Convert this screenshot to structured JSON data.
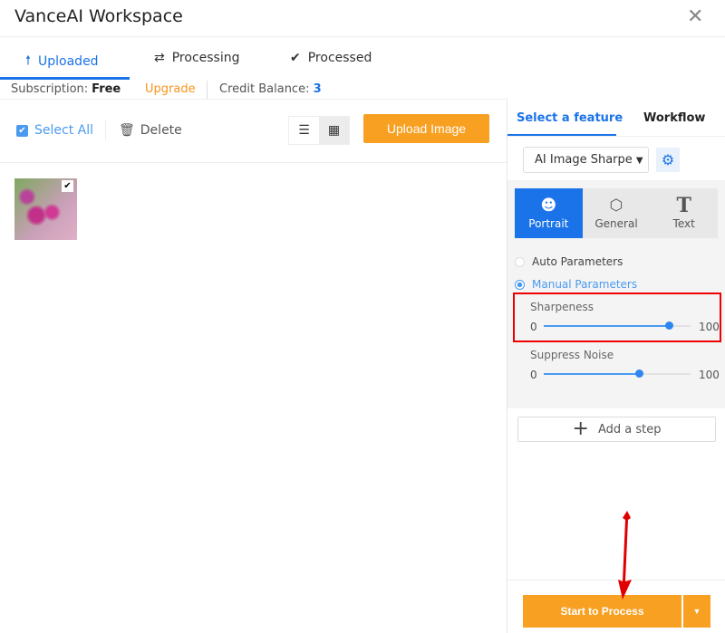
{
  "window": {
    "title": "VanceAI Workspace",
    "close_icon": "close-icon"
  },
  "tabs": [
    {
      "label": "Uploaded",
      "icon": "upload-arrow-icon",
      "active": true
    },
    {
      "label": "Processing",
      "icon": "sync-icon"
    },
    {
      "label": "Processed",
      "icon": "check-circle-icon"
    }
  ],
  "account": {
    "subscription_label": "Subscription:",
    "subscription_value": "Free",
    "upgrade": "Upgrade",
    "credit_label": "Credit Balance:",
    "credit_value": "3"
  },
  "toolbar": {
    "select_all": "Select All",
    "delete": "Delete",
    "upload": "Upload Image",
    "view_mode": "grid"
  },
  "images": [
    {
      "selected": true
    }
  ],
  "right_panel": {
    "tabs": [
      "Select a feature",
      "Workflow"
    ],
    "feature": "AI Image Sharpener",
    "feature_display": "AI Image Sharpe",
    "modes": [
      {
        "label": "Portrait",
        "icon": "portrait-icon",
        "active": true
      },
      {
        "label": "General",
        "icon": "cube-icon"
      },
      {
        "label": "Text",
        "icon": "text-t-icon"
      }
    ],
    "params": {
      "auto": "Auto Parameters",
      "manual": "Manual Parameters",
      "selected": "manual"
    },
    "sliders": [
      {
        "label": "Sharpeness",
        "min": "0",
        "max": "100",
        "value": 85
      },
      {
        "label": "Suppress Noise",
        "min": "0",
        "max": "100",
        "value": 65
      }
    ],
    "add_step": "Add a step",
    "start": "Start to Process"
  },
  "colors": {
    "accent": "#1a73e8",
    "orange": "#f7a022",
    "highlight": "#e00000"
  }
}
